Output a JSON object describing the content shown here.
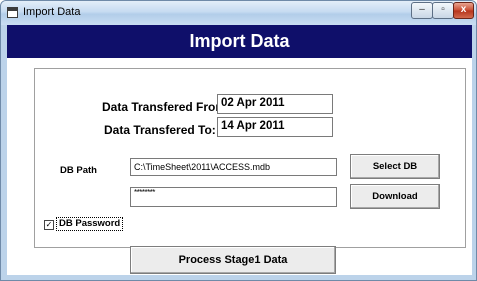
{
  "window": {
    "title": "Import Data",
    "min_glyph": "–",
    "max_glyph": "▫",
    "close_glyph": "x"
  },
  "banner": {
    "title": "Import Data"
  },
  "form": {
    "from_label": "Data Transfered From:",
    "from_value": "02 Apr 2011",
    "to_label": "Data Transfered To:",
    "to_value": "14 Apr 2011",
    "db_path_label": "DB Path",
    "db_path_value": "C:\\TimeSheet\\2011\\ACCESS.mdb",
    "db_password_checked": true,
    "db_password_label": "DB Password",
    "db_password_value": "********"
  },
  "buttons": {
    "select_db": "Select DB",
    "download": "Download",
    "process": "Process Stage1 Data"
  }
}
